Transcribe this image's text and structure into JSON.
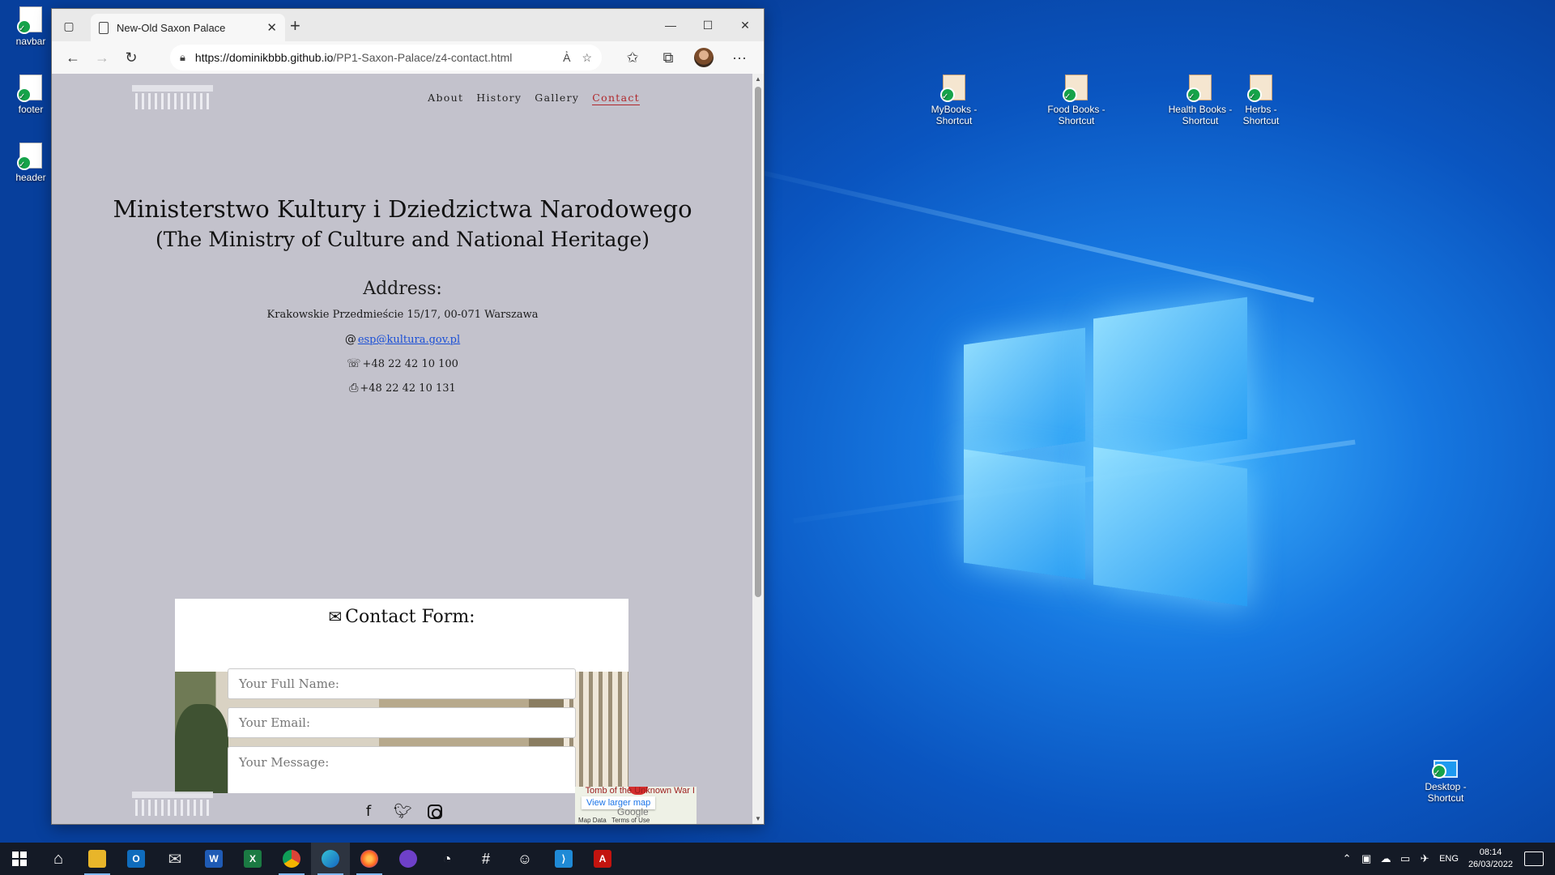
{
  "desktop": {
    "left_icons": [
      {
        "label": "navbar",
        "icon": "file-icon"
      },
      {
        "label": "footer",
        "icon": "file-icon"
      },
      {
        "label": "header",
        "icon": "file-icon"
      }
    ],
    "top_icons": [
      {
        "label": "MyBooks - Shortcut",
        "icon": "book-icon"
      },
      {
        "label": "Food Books - Shortcut",
        "icon": "book-icon"
      },
      {
        "label": "Health Books - Shortcut",
        "icon": "book-icon"
      },
      {
        "label": "Herbs - Shortcut",
        "icon": "book-icon"
      }
    ],
    "corner_icon": {
      "label": "Desktop - Shortcut",
      "icon": "desktop-icon"
    }
  },
  "browser": {
    "tab_title": "New-Old Saxon Palace",
    "url_host": "https://dominikbbb.github.io",
    "url_path": "/PP1-Saxon-Palace/z4-contact.html",
    "toolbar_icons": [
      "back-icon",
      "forward-icon",
      "refresh-icon",
      "lock-icon",
      "read-aloud-icon",
      "add-favorite-icon",
      "favorites-icon",
      "collections-icon",
      "profile-icon",
      "more-icon"
    ]
  },
  "site": {
    "nav": [
      "About",
      "History",
      "Gallery",
      "Contact"
    ],
    "active_nav": "Contact",
    "title": "Ministerstwo Kultury i Dziedzictwa Narodowego",
    "subtitle": "(The Ministry of Culture and National Heritage)",
    "address_heading": "Address:",
    "address": "Krakowskie Przedmieście 15/17, 00-071 Warszawa",
    "email": "esp@kultura.gov.pl",
    "phone": "+48 22 42 10 100",
    "fax": "+48 22 42 10 131",
    "form_title": "Contact Form:",
    "form": {
      "name_placeholder": "Your Full Name:",
      "email_placeholder": "Your Email:",
      "message_placeholder": "Your Message:"
    },
    "social": [
      "facebook-icon",
      "twitter-icon",
      "instagram-icon"
    ],
    "map": {
      "link": "View larger map",
      "brand": "Google",
      "label_fragment": "Tomb of the Unknown War I",
      "footer_data": "Map Data",
      "footer_terms": "Terms of Use"
    }
  },
  "taskbar": {
    "apps": [
      "windows-start-icon",
      "home-icon",
      "file-explorer-icon",
      "outlook-icon",
      "mail-icon",
      "word-icon",
      "excel-icon",
      "chrome-icon",
      "edge-icon",
      "firefox-icon",
      "github-desktop-icon",
      "speedometer-icon",
      "slack-icon",
      "emoji-app-icon",
      "vscode-icon",
      "acrobat-icon"
    ],
    "active_app": "edge-icon",
    "language": "ENG",
    "time": "08:14",
    "date": "26/03/2022"
  }
}
